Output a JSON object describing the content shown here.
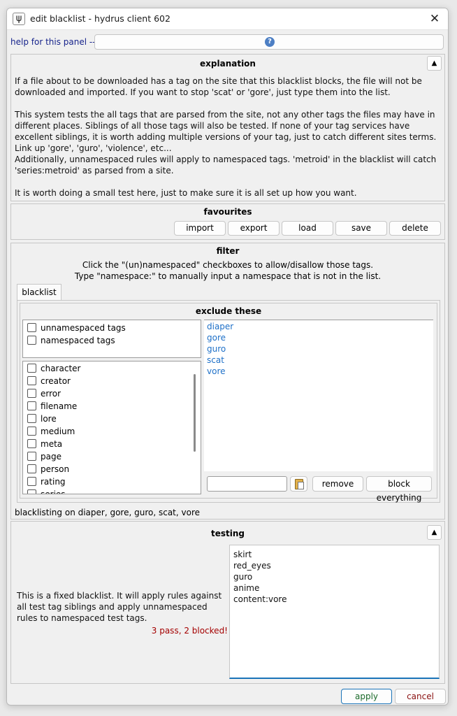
{
  "window": {
    "title": "edit blacklist - hydrus client 602",
    "app_icon": "ψ",
    "close_glyph": "✕"
  },
  "help": {
    "label": "help for this panel -->",
    "icon_glyph": "?"
  },
  "explanation": {
    "title": "explanation",
    "collapse_glyph": "▲",
    "para1": "If a file about to be downloaded has a tag on the site that this blacklist blocks, the file will not be downloaded and imported. If you want to stop 'scat' or 'gore', just type them into the list.",
    "para2": "This system tests the all tags that are parsed from the site, not any other tags the files may have in different places. Siblings of all those tags will also be tested. If none of your tag services have excellent siblings, it is worth adding multiple versions of your tag, just to catch different sites terms. Link up 'gore', 'guro', 'violence', etc...",
    "para3": "Additionally, unnamespaced rules will apply to namespaced tags. 'metroid' in the blacklist will catch 'series:metroid' as parsed from a site.",
    "para4": "It is worth doing a small test here, just to make sure it is all set up how you want."
  },
  "favourites": {
    "title": "favourites",
    "buttons": [
      "import",
      "export",
      "load",
      "save",
      "delete"
    ]
  },
  "filter": {
    "title": "filter",
    "hint1": "Click the \"(un)namespaced\" checkboxes to allow/disallow those tags.",
    "hint2": "Type \"namespace:\" to manually input a namespace that is not in the list.",
    "tab": "blacklist",
    "exclude_title": "exclude these",
    "global_checks": [
      "unnamespaced tags",
      "namespaced tags"
    ],
    "namespaces": [
      "character",
      "creator",
      "error",
      "filename",
      "lore",
      "medium",
      "meta",
      "page",
      "person",
      "rating",
      "series"
    ],
    "excluded_tags": [
      "diaper",
      "gore",
      "guro",
      "scat",
      "vore"
    ],
    "input_value": "",
    "remove_label": "remove",
    "block_everything_label": "block everything",
    "summary": "blacklisting on diaper, gore, guro, scat, vore"
  },
  "testing": {
    "title": "testing",
    "collapse_glyph": "▲",
    "description": "This is a fixed blacklist. It will apply rules against all test tag siblings and apply unnamespaced rules to namespaced test tags.",
    "result": "3 pass, 2 blocked!",
    "test_tags": [
      "skirt",
      "red_eyes",
      "guro",
      "anime",
      "content:vore"
    ]
  },
  "footer": {
    "apply_label": "apply",
    "cancel_label": "cancel"
  },
  "colors": {
    "accent_link": "#1e70c8",
    "result_red": "#a40000",
    "apply_border": "#1a73b8",
    "help_navy": "#17248c"
  }
}
